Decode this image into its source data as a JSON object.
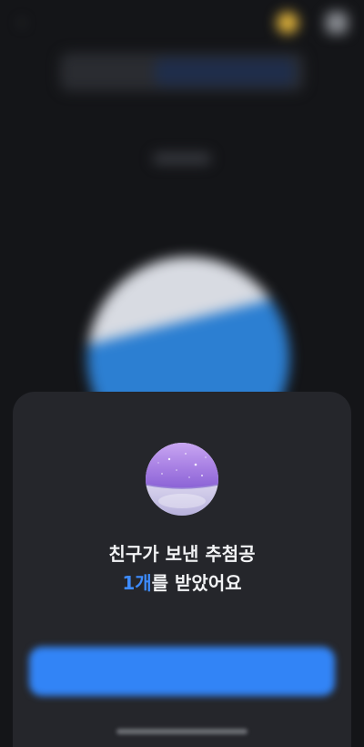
{
  "background": {
    "back_icon": "chevron-left-icon",
    "coin_icon": "coin-icon",
    "menu_icon": "menu-icon",
    "segment": {
      "left_label": "",
      "right_label": ""
    },
    "title": "",
    "ball_label": ""
  },
  "sheet": {
    "ball_icon": "purple-lottery-ball-icon",
    "message_line1": "친구가 보낸 추첨공",
    "message_count": "1개",
    "message_line2_rest": "를 받았어요",
    "confirm_label": "",
    "colors": {
      "accent": "#3d8bfd",
      "button": "#3284f6",
      "sheet_bg": "#25262b",
      "ball_top": "#a77fe3"
    }
  }
}
